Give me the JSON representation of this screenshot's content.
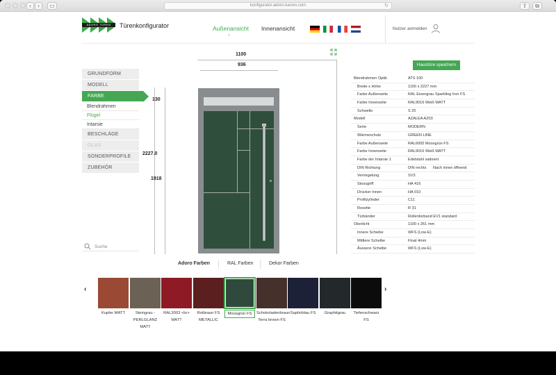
{
  "browser": {
    "url": "konfigurator.adoro-tueren.com"
  },
  "header": {
    "logo_text": "ADORO TÜREN",
    "title": "Türenkonfigurator",
    "nav": {
      "outside": "Außenansicht",
      "inside": "Innenansicht"
    },
    "login": "Nutzer anmelden",
    "colors": {
      "accent": "#45a753"
    }
  },
  "menu": {
    "items": [
      {
        "label": "GRUNDFORM"
      },
      {
        "label": "MODELL"
      },
      {
        "label": "FARBE"
      },
      {
        "label": "BESCHLÄGE"
      },
      {
        "label": "GLAS"
      },
      {
        "label": "SONDERPROFILE"
      },
      {
        "label": "ZUBEHÖR"
      }
    ],
    "sub": [
      "Blendrahmen",
      "Flügel",
      "Intarsie"
    ],
    "search_placeholder": "Suche"
  },
  "dimensions": {
    "width_outer": "1100",
    "width_inner": "936",
    "height_total": "2227.0",
    "height_top": "130",
    "height_lower": "1918"
  },
  "save_button": "Haustüre speichern",
  "spec": [
    {
      "k": "Blendrahmen Optik",
      "v": "ATS 100",
      "ind": false
    },
    {
      "k": "Breite x Höhe",
      "v": "1100 x 2227 mm",
      "ind": true
    },
    {
      "k": "Farbe Außenseite",
      "v": "RAL Eisengrau Sparkling Iron FS",
      "ind": true
    },
    {
      "k": "Farbe Innenseite",
      "v": "RAL9016 Weiß MATT",
      "ind": true
    },
    {
      "k": "Schwelle",
      "v": "S 20",
      "ind": true
    },
    {
      "k": "Modell",
      "v": "AZALEA AZ03",
      "ind": false
    },
    {
      "k": "Serie",
      "v": "MODERN",
      "ind": true
    },
    {
      "k": "Wärmeschutz",
      "v": "GREEN LINE",
      "ind": true
    },
    {
      "k": "Farbe Außenseite",
      "v": "RAL6005 Moosgrün FS",
      "ind": true
    },
    {
      "k": "Farbe Innenseite",
      "v": "RAL9016 Weiß MATT",
      "ind": true
    },
    {
      "k": "Farbe der Intarsie 1",
      "v": "Edelstahl satiniert",
      "ind": true
    },
    {
      "k": "DIN Richtung",
      "v": "DIN rechts",
      "v2": "Nach innen öffnend",
      "ind": true
    },
    {
      "k": "Verriegelung",
      "v": "SV3",
      "ind": true
    },
    {
      "k": "Stossgriff",
      "v": "HA 416",
      "ind": true
    },
    {
      "k": "Drücker Innen",
      "v": "HA 010",
      "ind": true
    },
    {
      "k": "Profilzylinder",
      "v": "C11",
      "ind": true
    },
    {
      "k": "Rosette",
      "v": "R 31",
      "ind": true
    },
    {
      "k": "Türbänder",
      "v": "Rollentürband EV1 standard",
      "ind": true
    },
    {
      "k": "Oberlicht",
      "v": "1100 x 261 mm",
      "ind": false
    },
    {
      "k": "Innere Scheibe",
      "v": "WFS (Low-E)",
      "ind": true
    },
    {
      "k": "Mittlere Scheibe",
      "v": "Float 4mm",
      "ind": true
    },
    {
      "k": "Äussere Scheibe",
      "v": "WFS (Low-E)",
      "ind": true
    }
  ],
  "color_tabs": [
    "Adoro Farben",
    "RAL Farben",
    "Dekor Farben"
  ],
  "swatches": [
    {
      "label": "Kupfer MATT",
      "color": "#9a4a34"
    },
    {
      "label": "Steingrau - PERLGLANZ MATT",
      "color": "#6b6155"
    },
    {
      "label": "RAL3003 <br> MATT",
      "color": "#8d1a24"
    },
    {
      "label": "Rotbraun FS METALLIC",
      "color": "#5c1f1f"
    },
    {
      "label": "Moosgrün FS",
      "color": "#2f4a3c"
    },
    {
      "label": "Schokoladenbraun Terra brown FS",
      "color": "#46302c"
    },
    {
      "label": "Saphirblau FS",
      "color": "#1c2138"
    },
    {
      "label": "Graphitgrau",
      "color": "#23292b"
    },
    {
      "label": "Tiefenschwarz FS",
      "color": "#0c0c0d"
    }
  ]
}
